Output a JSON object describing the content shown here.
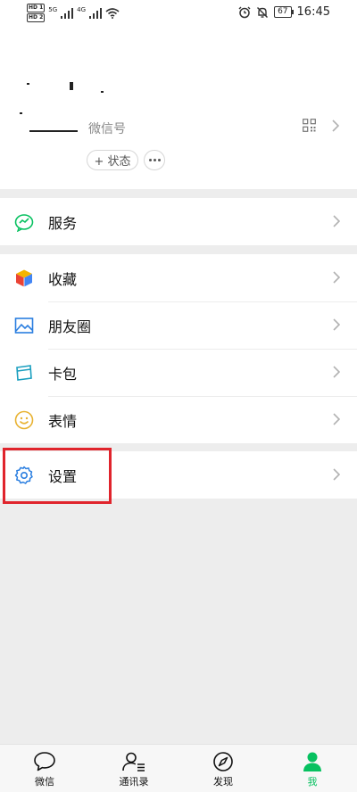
{
  "status_bar": {
    "hd1": "HD 1",
    "hd2": "HD 2",
    "signal1": "5G",
    "signal2": "4G",
    "battery": "67",
    "time": "16:45",
    "icons": [
      "wifi-icon",
      "alarm-icon",
      "mute-icon",
      "battery-icon"
    ]
  },
  "profile": {
    "wechat_id_label": "微信号",
    "status_label": "+ 状态"
  },
  "menu": {
    "services": "服务",
    "favorites": "收藏",
    "moments": "朋友圈",
    "cards": "卡包",
    "stickers": "表情",
    "settings": "设置"
  },
  "tabbar": {
    "chats": "微信",
    "contacts": "通讯录",
    "discover": "发现",
    "me": "我"
  },
  "colors": {
    "accent": "#07c160",
    "highlight": "#e0242c",
    "background": "#ededed"
  }
}
